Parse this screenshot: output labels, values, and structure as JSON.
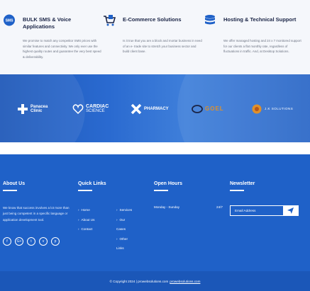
{
  "services": [
    {
      "icon": "sms-bubble-icon",
      "title": "BULK SMS & Voice Applications",
      "text": "We promise to match any competitor SMS prices with similar features and connectivity. We only ever use the highest quality routes and guarantee the very best speed & deliverability."
    },
    {
      "icon": "shopping-cart-icon",
      "title": "E-Commerce Solutions",
      "text": "Is it true that you are a block and mortar business in need of an e- trade site to stretch your business sector and build client base."
    },
    {
      "icon": "database-icon",
      "title": "Hosting & Technical Support",
      "text": "We offer managed hosting and 24 x 7 monitored support for our clients a flat monthly rate, regardless of fluctuations in traffic. And, at Desktop Solutions."
    }
  ],
  "clients": [
    {
      "name": "Panacea Clinic",
      "line1": "Panacea",
      "line2": "Clinic"
    },
    {
      "name": "Cardiac Science",
      "line1": "CARDIAC",
      "line2": "SCIENCE"
    },
    {
      "name": "X Pharmacy",
      "line1": "PHARMACY",
      "line2": ""
    },
    {
      "name": "Goel",
      "line1": "GOEL",
      "line2": ""
    },
    {
      "name": "J.K Solutions",
      "line1": "J.K SOLUTIONS",
      "line2": ""
    }
  ],
  "footer": {
    "about": {
      "heading": "About Us",
      "text": "We know that success involves a lot more than just being competent in a specific language or application development tool."
    },
    "quick_links": {
      "heading": "Quick Links",
      "col1": [
        "Home",
        "About Us",
        "Contact"
      ],
      "col2": [
        "Services",
        "Our Cases",
        "Other Links"
      ]
    },
    "hours": {
      "heading": "Open Hours",
      "days": "Monday - Sunday",
      "time": "24/7"
    },
    "newsletter": {
      "heading": "Newsletter",
      "placeholder": "Email Address"
    },
    "copyright": "© Copyright 2024 | prowebsolutions.com",
    "copyright_link": "prowebsolutions.com"
  },
  "colors": {
    "primary": "#1f61c8",
    "dark_text": "#1a2446",
    "body_text": "#6c7382",
    "accent_logo": "#e0902a"
  }
}
